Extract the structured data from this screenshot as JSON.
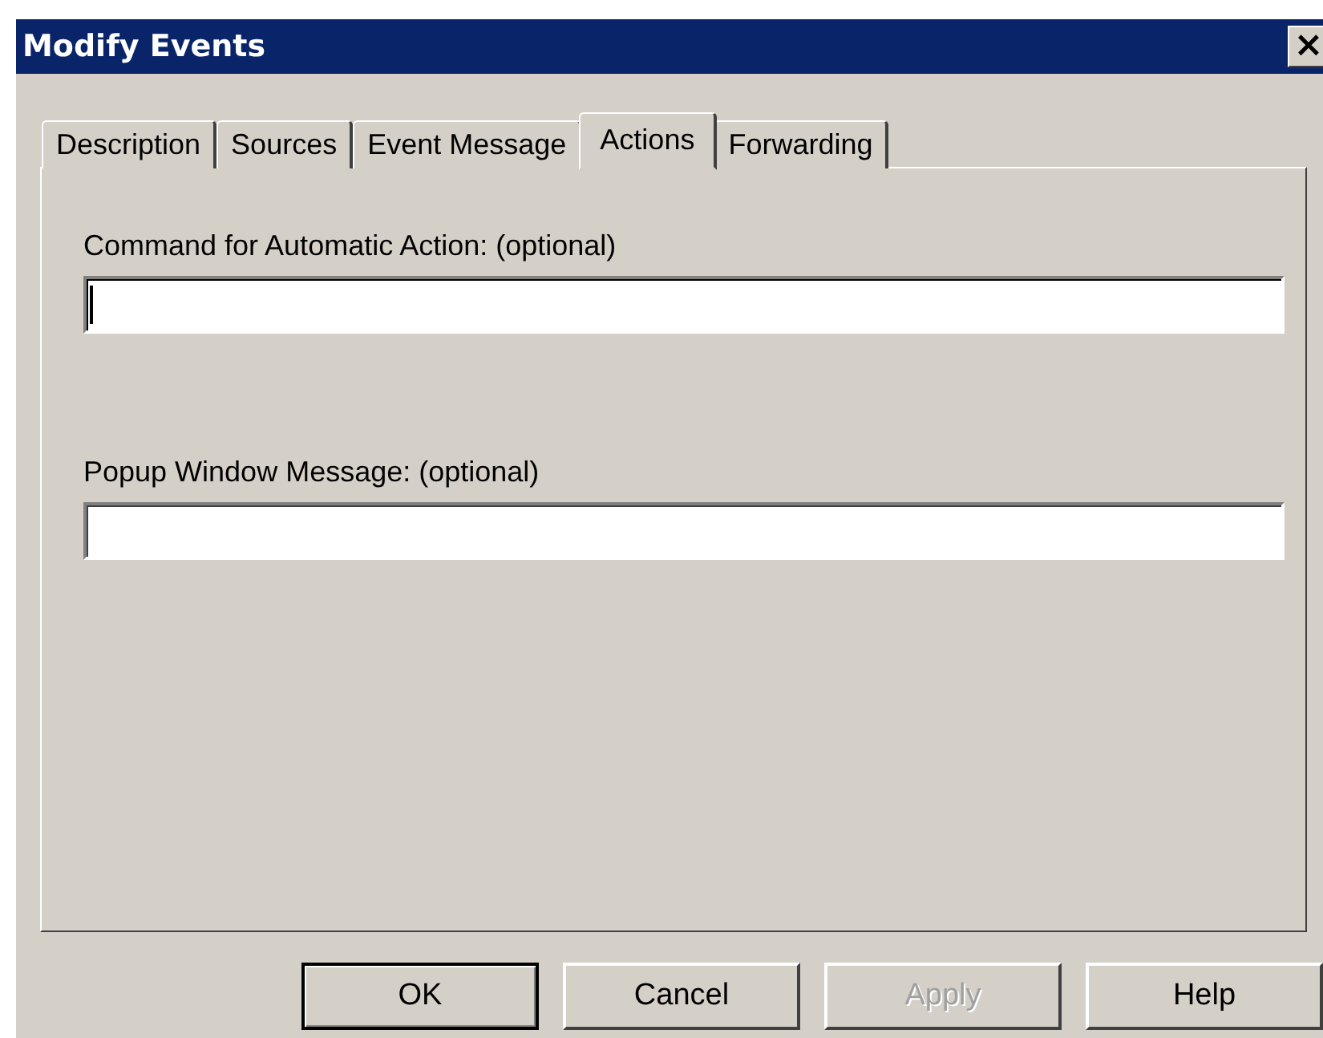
{
  "window": {
    "title": "Modify Events",
    "close": "×"
  },
  "tabs": [
    {
      "label": "Description",
      "selected": false
    },
    {
      "label": "Sources",
      "selected": false
    },
    {
      "label": "Event Message",
      "selected": false
    },
    {
      "label": "Actions",
      "selected": true
    },
    {
      "label": "Forwarding",
      "selected": false
    }
  ],
  "fields": [
    {
      "label": "Command for Automatic Action: (optional)",
      "focused": true
    },
    {
      "label": "Popup Window Message: (optional)",
      "focused": false
    }
  ],
  "buttons": [
    {
      "label": "OK",
      "default": true,
      "disabled": false
    },
    {
      "label": "Cancel",
      "default": false,
      "disabled": false
    },
    {
      "label": "Apply",
      "default": false,
      "disabled": true
    },
    {
      "label": "Help",
      "default": false,
      "disabled": false
    }
  ]
}
